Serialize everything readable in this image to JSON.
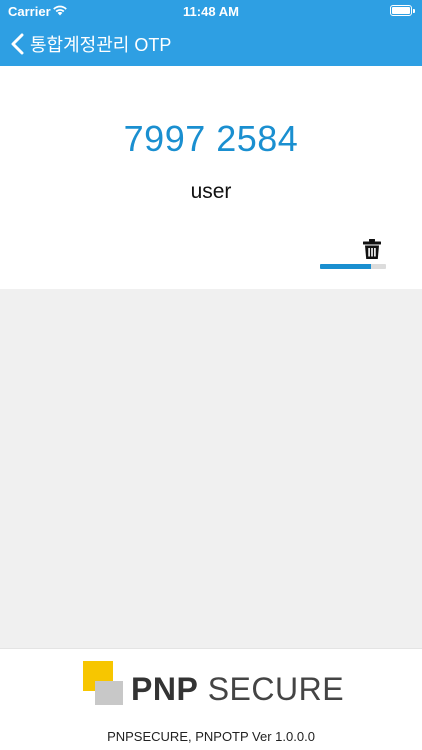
{
  "status_bar": {
    "carrier": "Carrier",
    "time": "11:48 AM",
    "battery_icon": "battery-full-icon",
    "wifi_icon": "wifi-icon"
  },
  "nav": {
    "title": "통합계정관리 OTP",
    "back_icon": "chevron-left-icon"
  },
  "otp": {
    "code": "7997 2584",
    "account": "user",
    "delete_icon": "trash-icon",
    "remaining_fraction": 0.77
  },
  "footer": {
    "logo_bold": "PNP",
    "logo_light": "SECURE",
    "version_text": "PNPSECURE, PNPOTP Ver 1.0.0.0"
  },
  "colors": {
    "header": "#2e9fe3",
    "accent": "#1a8fd0",
    "logo_yellow": "#f7c600",
    "logo_gray": "#c8c8c8"
  }
}
